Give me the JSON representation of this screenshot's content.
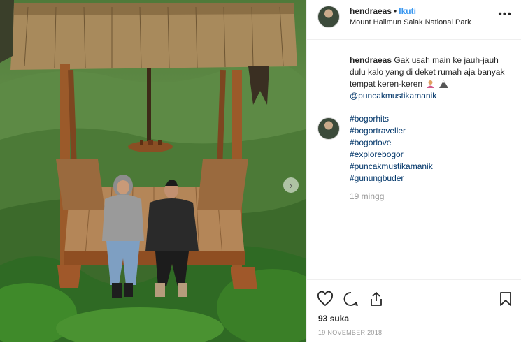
{
  "post": {
    "username": "hendraeas",
    "separator": "•",
    "follow_label": "Ikuti",
    "location": "Mount Halimun Salak National Park"
  },
  "caption": {
    "username": "hendraeas",
    "text": "Gak usah main ke jauh-jauh dulu kalo yang di deket rumah aja banyak tempat keren-keren",
    "mention": "@puncakmustikamanik"
  },
  "hashtags": [
    "#bogorhits",
    "#bogortraveller",
    "#bogorlove",
    "#explorebogor",
    "#puncakmustikamanik",
    "#gunungbuder"
  ],
  "time_ago": "19 mingg",
  "likes": "93 suka",
  "date": "19 NOVEMBER 2018",
  "icons": {
    "more": "more-options-icon",
    "like": "heart-icon",
    "comment": "comment-icon",
    "share": "share-icon",
    "save": "bookmark-icon",
    "next": "chevron-right-icon"
  },
  "colors": {
    "link": "#003569",
    "follow": "#3897f0",
    "muted": "#999999"
  }
}
